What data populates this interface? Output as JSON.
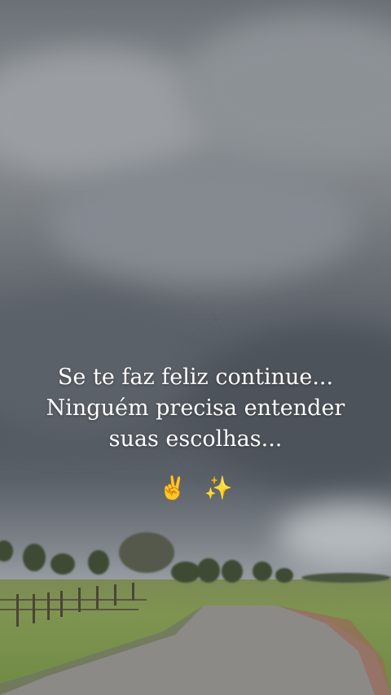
{
  "caption": {
    "line1": "Se te faz feliz continue...",
    "line2": "Ninguém precisa entender",
    "line3": "suas escolhas..."
  },
  "emojis": [
    "✌️",
    "✨"
  ],
  "colors": {
    "sky": "#6b7076",
    "grass": "#6f8a44",
    "road": "#8a8a88",
    "text": "#ffffff"
  }
}
